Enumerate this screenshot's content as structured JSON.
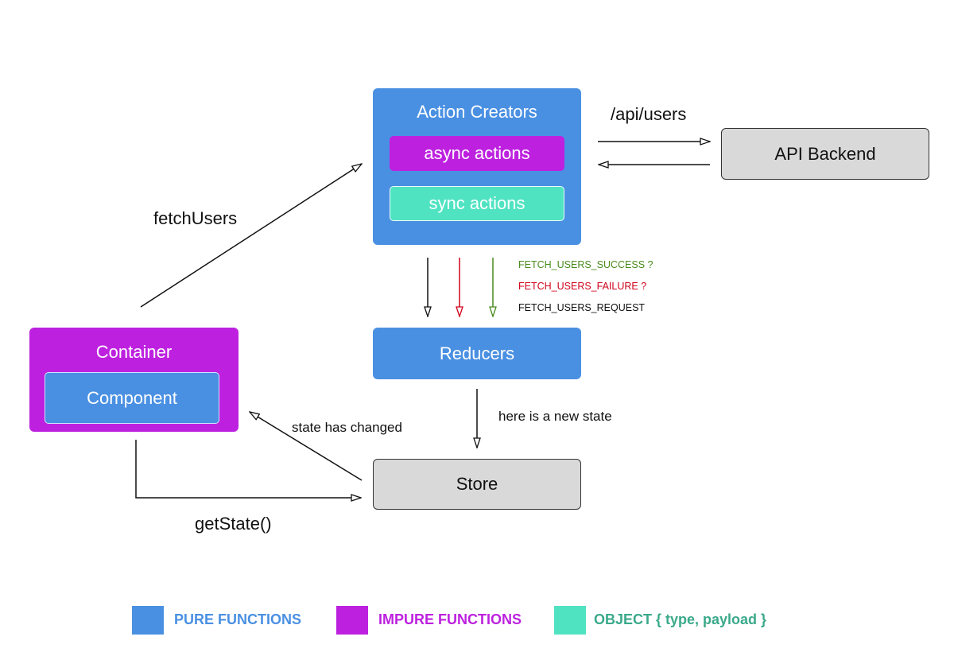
{
  "colors": {
    "pure": "#4a90e2",
    "impure": "#bd21df",
    "object": "#50e3c2",
    "success": "#4a8b1d",
    "failure": "#d0021b",
    "request": "#111111"
  },
  "nodes": {
    "action_creators": {
      "title": "Action Creators",
      "async": "async actions",
      "sync": "sync actions"
    },
    "api_backend": "API Backend",
    "reducers": "Reducers",
    "store": "Store",
    "container": {
      "title": "Container",
      "component": "Component"
    }
  },
  "edges": {
    "api_call": "/api/users",
    "fetch_users": "fetchUsers",
    "new_state": "here is a new state",
    "state_changed": "state has changed",
    "get_state": "getState()"
  },
  "actions": [
    {
      "label": "FETCH_USERS_SUCCESS ?",
      "status": "success"
    },
    {
      "label": "FETCH_USERS_FAILURE ?",
      "status": "failure"
    },
    {
      "label": "FETCH_USERS_REQUEST",
      "status": "request"
    }
  ],
  "legend": [
    {
      "label": "PURE FUNCTIONS",
      "color": "#4a90e2",
      "text_color": "#4a90e2"
    },
    {
      "label": "IMPURE FUNCTIONS",
      "color": "#bd21df",
      "text_color": "#bd21df"
    },
    {
      "label": "OBJECT { type, payload }",
      "color": "#50e3c2",
      "text_color": "#3aa98a"
    }
  ]
}
